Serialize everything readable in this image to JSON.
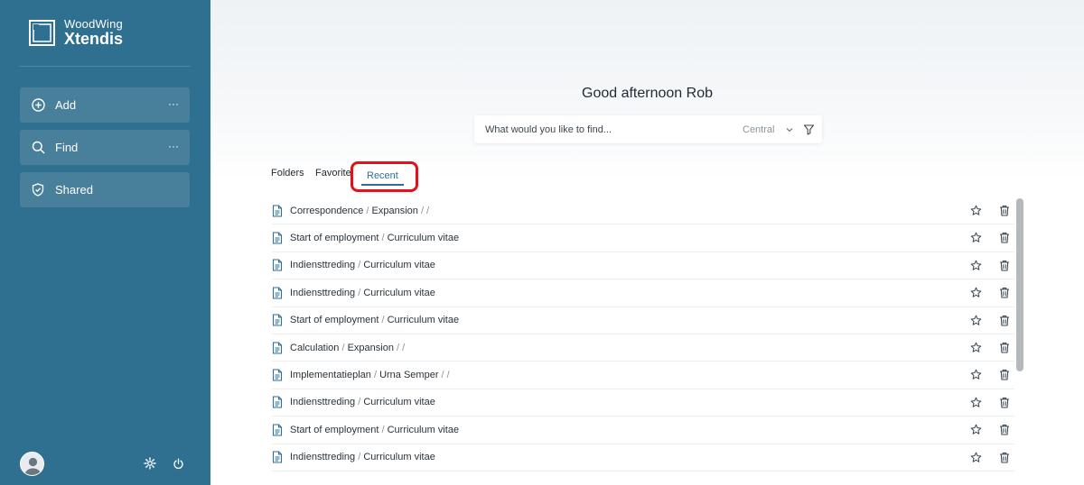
{
  "brand": {
    "line1": "WoodWing",
    "line2": "Xtendis"
  },
  "sidebar": {
    "items": [
      {
        "label": "Add",
        "more": "···"
      },
      {
        "label": "Find",
        "more": "···"
      },
      {
        "label": "Shared"
      }
    ]
  },
  "main": {
    "greeting": "Good afternoon Rob",
    "search": {
      "placeholder": "What would you like to find...",
      "scope": "Central"
    },
    "tabs": [
      {
        "label": "Folders"
      },
      {
        "label": "Favorites"
      },
      {
        "label": "Recent",
        "active": true
      }
    ]
  },
  "recent": [
    {
      "name": "Correspondence",
      "sep1": " / ",
      "sub": "Expansion",
      "tail": " / /"
    },
    {
      "name": "Start of employment",
      "sep1": " / ",
      "sub": "Curriculum vitae",
      "tail": ""
    },
    {
      "name": "Indiensttreding",
      "sep1": " / ",
      "sub": "Curriculum vitae",
      "tail": ""
    },
    {
      "name": "Indiensttreding",
      "sep1": " / ",
      "sub": "Curriculum vitae",
      "tail": ""
    },
    {
      "name": "Start of employment",
      "sep1": " / ",
      "sub": "Curriculum vitae",
      "tail": ""
    },
    {
      "name": "Calculation",
      "sep1": " / ",
      "sub": "Expansion",
      "tail": " / /"
    },
    {
      "name": "Implementatieplan",
      "sep1": " / ",
      "sub": "Urna Semper",
      "tail": " / /"
    },
    {
      "name": "Indiensttreding",
      "sep1": " / ",
      "sub": "Curriculum vitae",
      "tail": ""
    },
    {
      "name": "Start of employment",
      "sep1": " / ",
      "sub": "Curriculum vitae",
      "tail": ""
    },
    {
      "name": "Indiensttreding",
      "sep1": " / ",
      "sub": "Curriculum vitae",
      "tail": ""
    }
  ],
  "colors": {
    "sidebar": "#2f6f8f",
    "accent": "#2f6f8f",
    "highlight": "#e0121b"
  },
  "icons": {
    "add": "plus-circle-icon",
    "find": "search-icon",
    "shared": "shield-icon",
    "document": "document-icon",
    "favorite": "star-icon",
    "delete": "trash-icon",
    "settings": "gear-icon",
    "logout": "power-icon",
    "filter": "funnel-icon"
  }
}
